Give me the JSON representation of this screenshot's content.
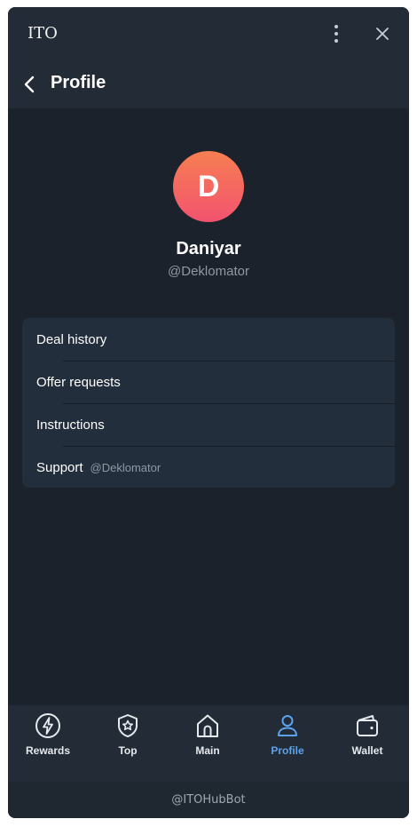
{
  "window": {
    "title": "ITO"
  },
  "header": {
    "title": "Profile"
  },
  "profile": {
    "avatar_letter": "D",
    "name": "Daniyar",
    "handle": "@Deklomator"
  },
  "menu": {
    "items": [
      {
        "label": "Deal history"
      },
      {
        "label": "Offer requests"
      },
      {
        "label": "Instructions"
      },
      {
        "label": "Support",
        "sub": "@Deklomator"
      }
    ]
  },
  "tabs": [
    {
      "label": "Rewards",
      "icon": "lightning-icon"
    },
    {
      "label": "Top",
      "icon": "star-badge-icon"
    },
    {
      "label": "Main",
      "icon": "home-icon"
    },
    {
      "label": "Profile",
      "icon": "user-icon",
      "active": true
    },
    {
      "label": "Wallet",
      "icon": "wallet-icon"
    }
  ],
  "footer": {
    "bot_name": "@ITOHubBot"
  },
  "colors": {
    "background": "#1b222b",
    "panel": "#222b36",
    "menu_card": "#222e3c",
    "accent": "#5ba3ee",
    "avatar_gradient_top": "#f77f52",
    "avatar_gradient_bottom": "#f2536f"
  }
}
